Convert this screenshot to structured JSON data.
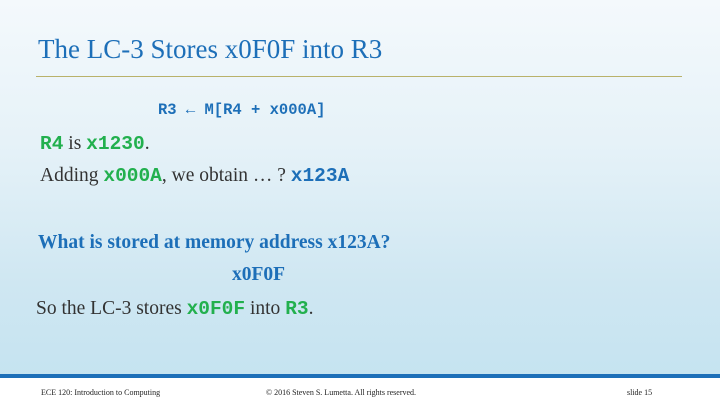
{
  "slide": {
    "title": "The LC-3 Stores x0F0F into R3",
    "rtl": {
      "text": "R3 ← M[R4 + x000A]"
    },
    "r4_line": {
      "reg": "R4",
      "is": " is ",
      "value": "x1230",
      "end": "."
    },
    "add_line": {
      "lead": "Adding ",
      "offset": "x000A",
      "mid": ", we obtain … ? ",
      "address": "x123A"
    },
    "question": "What is stored at memory address x123A?",
    "answer": "x0F0F",
    "conclusion": {
      "lead": "So the LC-3 stores ",
      "value": "x0F0F",
      "mid": " into ",
      "reg": "R3",
      "end": "."
    }
  },
  "footer": {
    "course": "ECE 120: Introduction to Computing",
    "copyright": "© 2016 Steven S. Lumetta.  All rights reserved.",
    "slide_number": "slide 15"
  },
  "colors": {
    "title_blue": "#1d6fb8",
    "highlight_green": "#22b04e",
    "rule_olive": "#b9b26a"
  }
}
